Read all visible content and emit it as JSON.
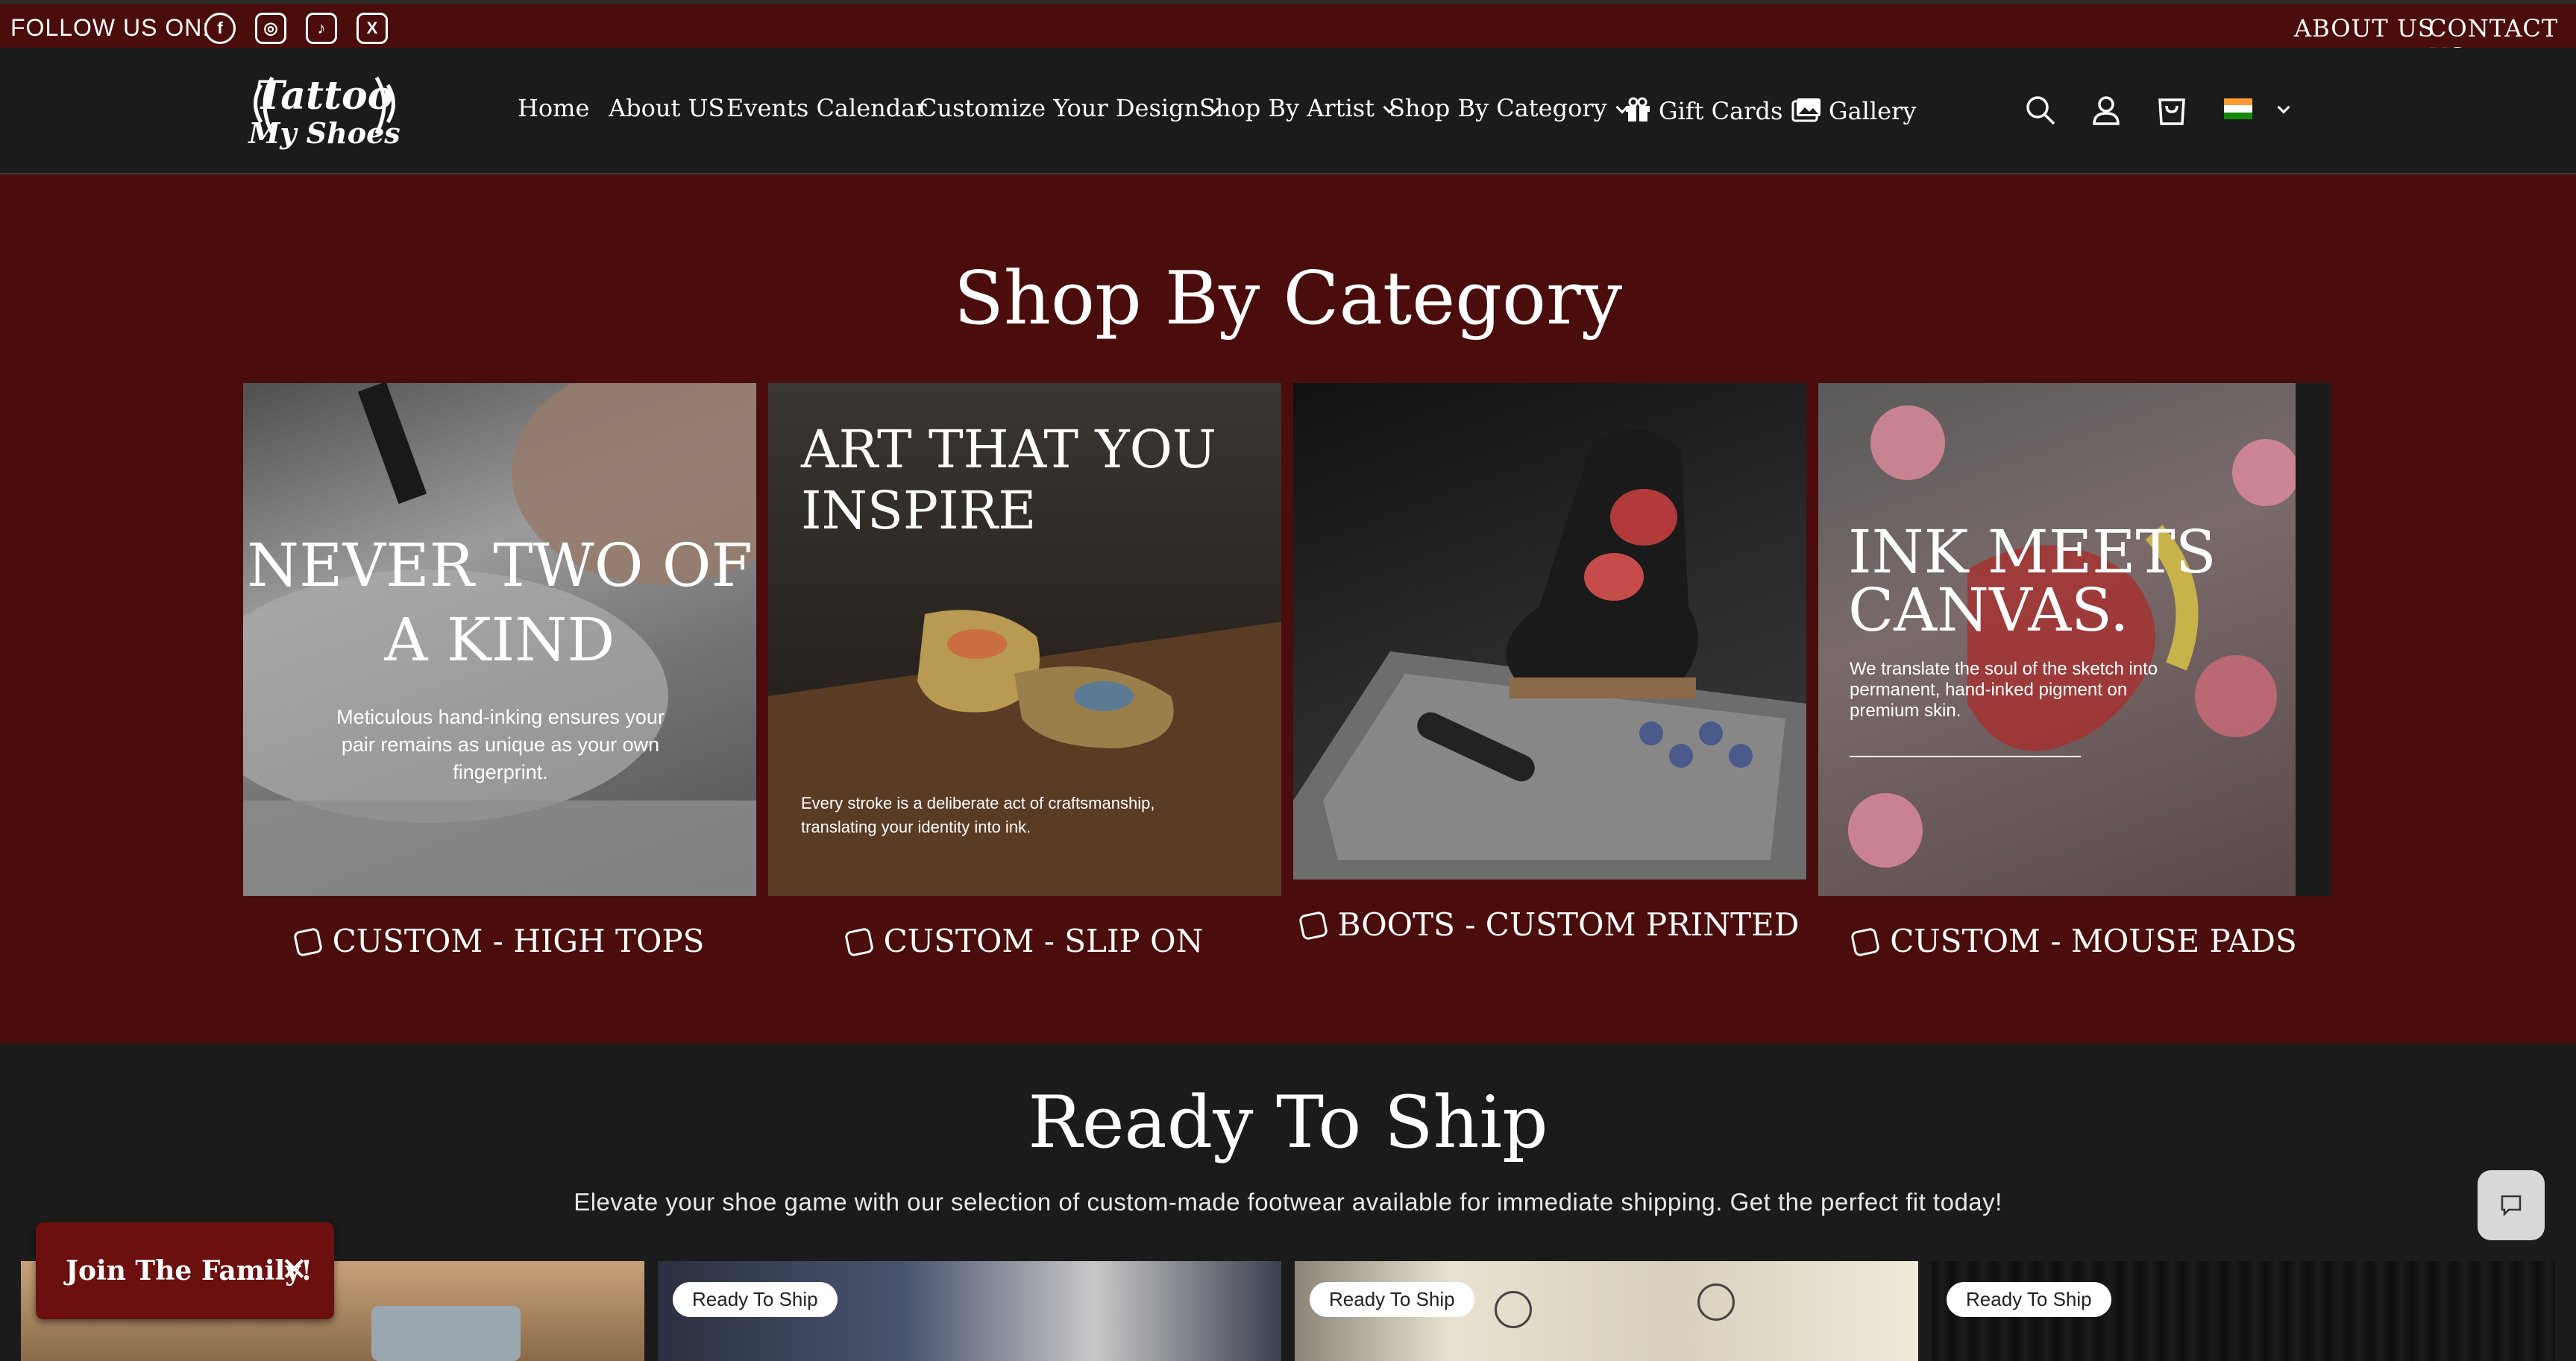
{
  "topbar": {
    "follow_label": "FOLLOW US ON:",
    "social": [
      {
        "icon": "facebook-icon",
        "glyph": "f"
      },
      {
        "icon": "instagram-icon",
        "glyph": "◎"
      },
      {
        "icon": "tiktok-icon",
        "glyph": "♪"
      },
      {
        "icon": "x-icon",
        "glyph": "X"
      }
    ],
    "about_link": "ABOUT US",
    "contact_link": "CONTACT US"
  },
  "header": {
    "logo_line1": "Tattoo",
    "logo_line2": "My Shoes",
    "nav": {
      "home": "Home",
      "about": "About US",
      "events": "Events Calendar",
      "customize": "Customize Your Design",
      "shop_artist": "Shop By Artist",
      "shop_category": "Shop By Category",
      "gift_cards": "Gift Cards",
      "gallery": "Gallery"
    },
    "icons": [
      "search-icon",
      "account-icon",
      "cart-icon",
      "country-flag-icon"
    ]
  },
  "category": {
    "title": "Shop By Category",
    "cards": [
      {
        "headline_line1": "NEVER TWO OF",
        "headline_line2": "A KIND",
        "text": "Meticulous hand-inking ensures your pair remains as unique as your own fingerprint.",
        "label": "CUSTOM - HIGH TOPS"
      },
      {
        "headline_line1": "ART THAT YOU",
        "headline_line2": "INSPIRE",
        "text": "Every stroke is a deliberate act of craftsmanship, translating your identity into ink.",
        "label": "CUSTOM - SLIP ON"
      },
      {
        "label": "BOOTS - CUSTOM PRINTED"
      },
      {
        "headline_line1": "INK MEETS",
        "headline_line2": "CANVAS.",
        "text": "We translate the soul of the sketch into permanent, hand-inked pigment on premium skin.",
        "label": "CUSTOM - MOUSE PADS"
      }
    ]
  },
  "ready": {
    "title": "Ready To Ship",
    "subtitle": "Elevate your shoe game with our selection of custom-made footwear available for immediate shipping. Get the perfect fit today!",
    "badge": "Ready To Ship"
  },
  "popup": {
    "join_label": "Join The Family!",
    "close_glyph": "✕"
  },
  "colors": {
    "brand_maroon": "#4a0d0c",
    "header_dark": "#1b1b1b",
    "popup_red": "#6b100f"
  }
}
